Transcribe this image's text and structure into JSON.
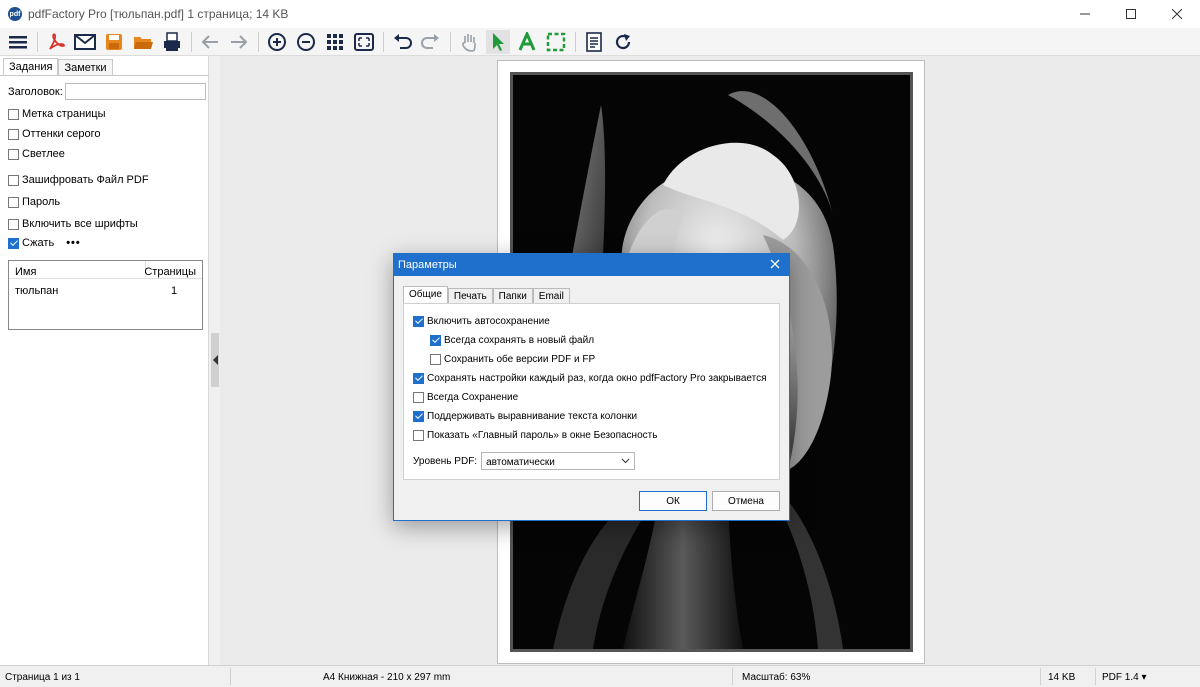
{
  "window": {
    "title": "pdfFactory Pro [тюльпан.pdf] 1 страница; 14 KB",
    "app_icon_label": "pdf"
  },
  "toolbar": {
    "icons": [
      "menu-icon",
      "pdf-icon",
      "mail-icon",
      "save-icon",
      "open-folder-icon",
      "print-icon",
      "back-arrow-icon",
      "forward-arrow-icon",
      "zoom-in-icon",
      "zoom-out-icon",
      "grid-icon",
      "fit-page-icon",
      "undo-icon",
      "redo-icon",
      "hand-icon",
      "pointer-icon",
      "text-tool-icon",
      "select-rect-icon",
      "notes-icon",
      "refresh-icon"
    ],
    "active": "pointer-icon"
  },
  "left_panel": {
    "tabs": [
      "Задания",
      "Заметки"
    ],
    "active_tab": "Задания",
    "title_label": "Заголовок:",
    "title_value": "",
    "options": [
      {
        "label": "Метка страницы",
        "checked": false
      },
      {
        "label": "Оттенки серого",
        "checked": false
      },
      {
        "label": "Светлее",
        "checked": false
      },
      {
        "label": "Зашифровать Файл PDF",
        "checked": false
      },
      {
        "label": "Пароль",
        "checked": false
      },
      {
        "label": "Включить все шрифты",
        "checked": false
      },
      {
        "label": "Сжать",
        "checked": true
      }
    ],
    "more": "•••",
    "list": {
      "headers": [
        "Имя",
        "Страницы"
      ],
      "rows": [
        {
          "name": "тюльпан",
          "pages": "1"
        }
      ]
    }
  },
  "status": {
    "page": "Страница 1 из 1",
    "format": "A4 Книжная - 210 x 297 mm",
    "zoom": "Масштаб: 63%",
    "size": "14 KB",
    "pdf_version": "PDF 1.4"
  },
  "dialog": {
    "title": "Параметры",
    "tabs": [
      "Общие",
      "Печать",
      "Папки",
      "Email"
    ],
    "active_tab": "Общие",
    "options": [
      {
        "label": "Включить автосохранение",
        "checked": true,
        "indent": 0
      },
      {
        "label": "Всегда сохранять в новый файл",
        "checked": true,
        "indent": 1
      },
      {
        "label": "Сохранить обе версии PDF и FP",
        "checked": false,
        "indent": 1
      },
      {
        "label": "Сохранять настройки каждый раз, когда окно pdfFactory Pro закрывается",
        "checked": true,
        "indent": 0
      },
      {
        "label": "Всегда Сохранение",
        "checked": false,
        "indent": 0
      },
      {
        "label": "Поддерживать выравнивание текста колонки",
        "checked": true,
        "indent": 0
      },
      {
        "label": "Показать «Главный пароль» в окне Безопасность",
        "checked": false,
        "indent": 0
      }
    ],
    "pdf_level_label": "Уровень PDF:",
    "pdf_level_value": "автоматически",
    "ok": "ОК",
    "cancel": "Отмена"
  },
  "colors": {
    "accent": "#1f6fcd",
    "icon_red": "#d8342c",
    "icon_orange": "#e8871e",
    "icon_green": "#1f9b3a",
    "icon_navy": "#1b2a4a"
  }
}
